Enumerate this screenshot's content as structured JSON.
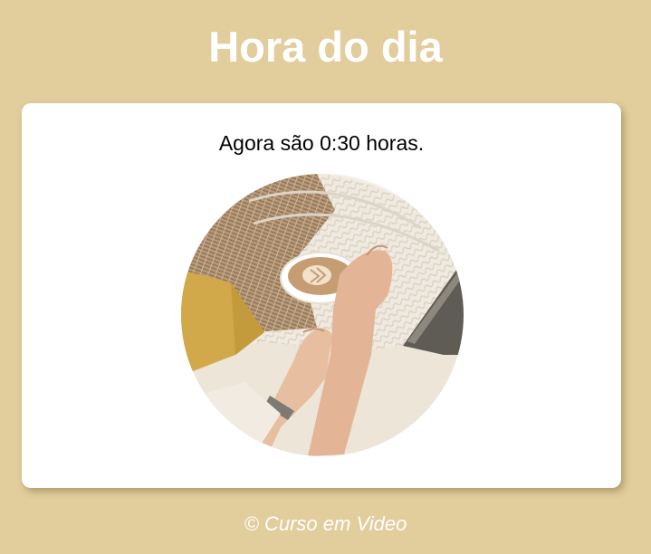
{
  "header": {
    "title": "Hora do dia"
  },
  "main": {
    "time_message": "Agora são 0:30 horas.",
    "image": {
      "description_icon": "coffee-photo",
      "colors": {
        "blanket": "#efe9df",
        "rug": "#b99c7c",
        "pillow": "#d3ab4c",
        "coffee": "#c8a27a",
        "skin": "#e4b99b",
        "laptop": "#6d6a60"
      }
    }
  },
  "footer": {
    "text": "© Curso em Video"
  },
  "theme": {
    "background": "#e2cd9c",
    "card": "#ffffff",
    "title_color": "#ffffff"
  }
}
